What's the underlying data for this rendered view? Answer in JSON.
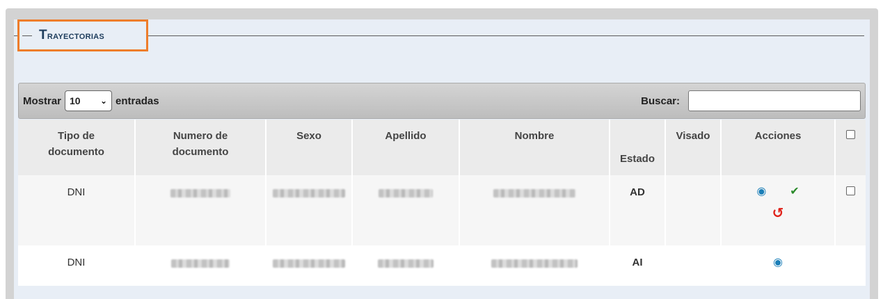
{
  "panel": {
    "title": "Trayectorias",
    "accent_color": "#ee7d2b"
  },
  "toolbar": {
    "show_label": "Mostrar",
    "page_size": "10",
    "entries_label": "entradas",
    "search_label": "Buscar:",
    "search_value": ""
  },
  "table": {
    "headers": {
      "tipo_l1": "Tipo de",
      "tipo_l2": "documento",
      "numero_l1": "Numero de",
      "numero_l2": "documento",
      "sexo": "Sexo",
      "apellido": "Apellido",
      "nombre": "Nombre",
      "estado": "Estado",
      "visado": "Visado",
      "acciones": "Acciones"
    },
    "rows": [
      {
        "tipo": "DNI",
        "estado": "AD",
        "actions": [
          "eye-icon",
          "check-icon",
          "undo-icon"
        ]
      },
      {
        "tipo": "DNI",
        "estado": "AI",
        "actions": [
          "eye-icon"
        ]
      }
    ]
  },
  "colors": {
    "title": "#1d3c5c",
    "estado": "#3a8a2c",
    "eye": "#1c7fb8",
    "check": "#2a8a2a",
    "undo": "#e0221a"
  }
}
